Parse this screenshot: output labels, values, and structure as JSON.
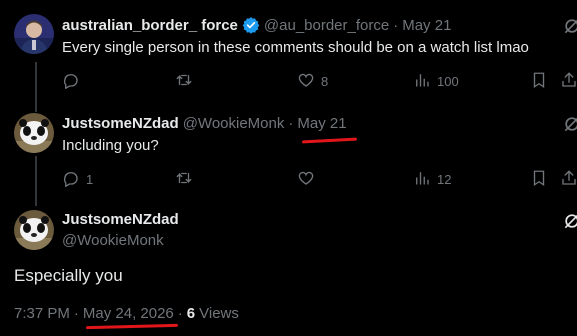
{
  "tweets": [
    {
      "author_name": "australian_border_ force",
      "verified": true,
      "handle": "@au_border_force",
      "dot": "·",
      "date": "May 21",
      "text": "Every single person in these comments should be on a watch list lmao",
      "replies": "",
      "reposts": "",
      "likes": "8",
      "views": "100"
    },
    {
      "author_name": "JustsomeNZdad",
      "handle": "@WookieMonk",
      "dot": "·",
      "date": "May 21",
      "text": "Including you?",
      "replies": "1",
      "reposts": "",
      "likes": "",
      "views": "12"
    }
  ],
  "focused": {
    "author_name": "JustsomeNZdad",
    "handle": "@WookieMonk",
    "text": "Especially you",
    "time": "7:37 PM",
    "dot1": "·",
    "date": "May 24, 2026",
    "dot2": "·",
    "views_count": "6",
    "views_label": "Views"
  },
  "colors": {
    "background": "#000000",
    "text": "#e7e9ea",
    "muted": "#71767b",
    "verified": "#1d9bf0",
    "annotation": "#e0161a"
  },
  "icons": [
    "grok-icon",
    "reply-icon",
    "repost-icon",
    "like-icon",
    "views-icon",
    "bookmark-icon",
    "share-icon",
    "verified-badge-icon"
  ]
}
